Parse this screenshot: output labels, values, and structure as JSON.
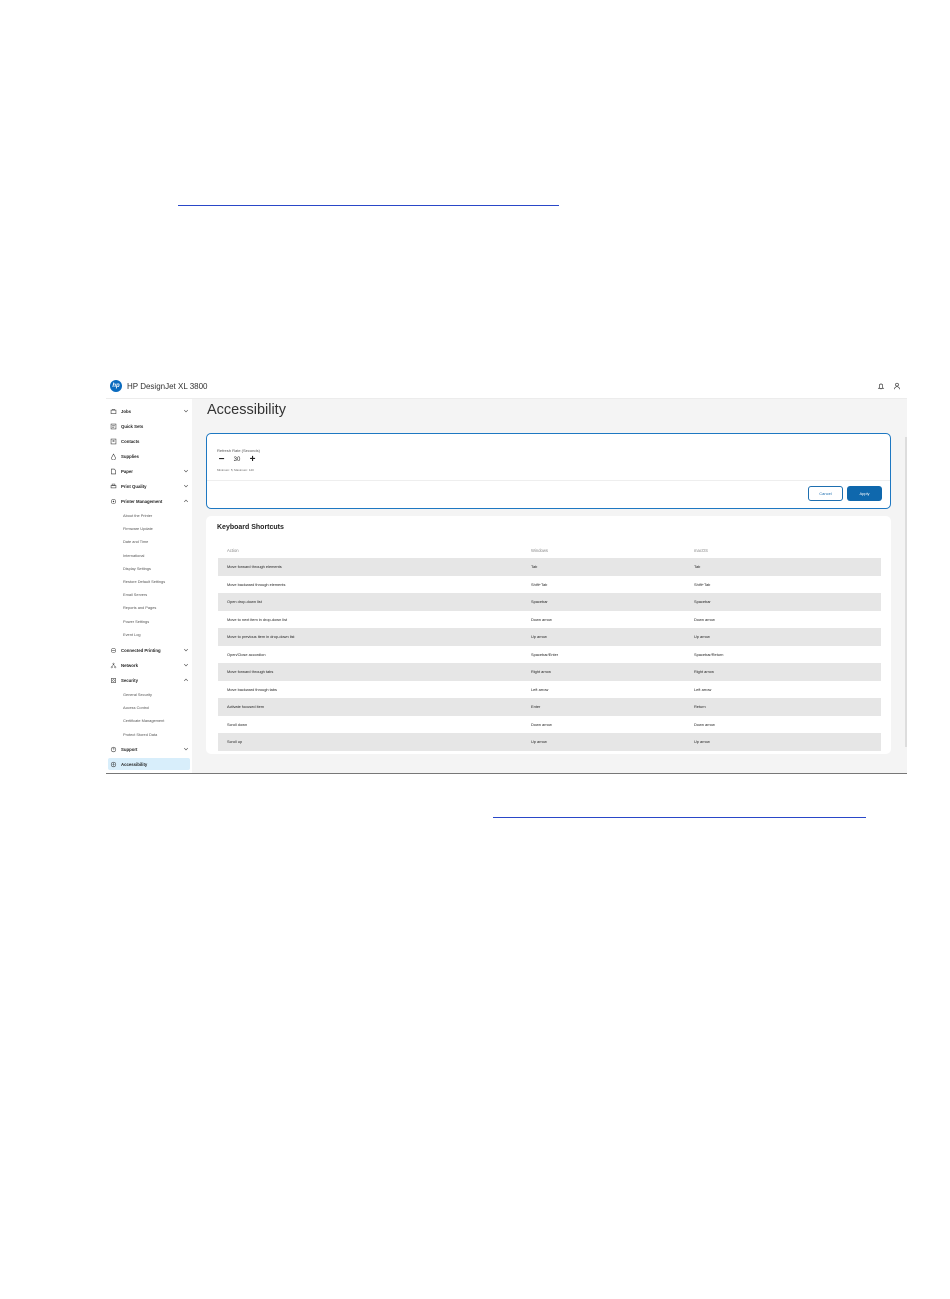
{
  "app": {
    "title": "HP DesignJet XL 3800",
    "logo_text": "hp"
  },
  "header_icons": [
    "bell-icon",
    "user-icon"
  ],
  "sidebar": {
    "items": [
      {
        "label": "Jobs",
        "icon": "jobs-icon",
        "expand": "down"
      },
      {
        "label": "Quick Sets",
        "icon": "quick-sets-icon"
      },
      {
        "label": "Contacts",
        "icon": "contacts-icon"
      },
      {
        "label": "Supplies",
        "icon": "supplies-icon"
      },
      {
        "label": "Paper",
        "icon": "paper-icon",
        "expand": "down"
      },
      {
        "label": "Print Quality",
        "icon": "print-quality-icon",
        "expand": "down"
      },
      {
        "label": "Printer Management",
        "icon": "printer-management-icon",
        "expand": "up"
      }
    ],
    "printer_management_sub": [
      "About the Printer",
      "Firmware Update",
      "Date and Time",
      "International",
      "Display Settings",
      "Restore Default Settings",
      "Email Servers",
      "Reports and Pages",
      "Power Settings",
      "Event Log"
    ],
    "items2": [
      {
        "label": "Connected Printing",
        "icon": "connected-printing-icon",
        "expand": "down"
      },
      {
        "label": "Network",
        "icon": "network-icon",
        "expand": "down"
      },
      {
        "label": "Security",
        "icon": "security-icon",
        "expand": "up"
      }
    ],
    "security_sub": [
      "General Security",
      "Access Control",
      "Certificate Management",
      "Protect Stored Data"
    ],
    "items3": [
      {
        "label": "Support",
        "icon": "support-icon",
        "expand": "down"
      },
      {
        "label": "Accessibility",
        "icon": "accessibility-icon",
        "active": true
      }
    ]
  },
  "page": {
    "title": "Accessibility",
    "refresh": {
      "label": "Refresh Rate (Seconds)",
      "value": "30",
      "hint": "Minimum: 5; Maximum: 120",
      "decrement": "−",
      "increment": "+"
    },
    "buttons": {
      "cancel": "Cancel",
      "apply": "Apply"
    },
    "shortcuts": {
      "heading": "Keyboard Shortcuts",
      "columns": [
        "Action",
        "Windows",
        "macOS"
      ],
      "rows": [
        [
          "Move forward through elements",
          "Tab",
          "Tab"
        ],
        [
          "Move backward through elements",
          "Shift+Tab",
          "Shift+Tab"
        ],
        [
          "Open drop-down list",
          "Spacebar",
          "Spacebar"
        ],
        [
          "Move to next item in drop-down list",
          "Down arrow",
          "Down arrow"
        ],
        [
          "Move to previous item in drop-down list",
          "Up arrow",
          "Up arrow"
        ],
        [
          "Open/Close accordion",
          "Spacebar/Enter",
          "Spacebar/Return"
        ],
        [
          "Move forward through tabs",
          "Right arrow",
          "Right arrow"
        ],
        [
          "Move backward through tabs",
          "Left arrow",
          "Left arrow"
        ],
        [
          "Activate focused item",
          "Enter",
          "Return"
        ],
        [
          "Scroll down",
          "Down arrow",
          "Down arrow"
        ],
        [
          "Scroll up",
          "Up arrow",
          "Up arrow"
        ]
      ]
    }
  },
  "colors": {
    "accent": "#0f68ad",
    "active_bg": "#d8eefb",
    "link_line": "#2a48c8"
  }
}
